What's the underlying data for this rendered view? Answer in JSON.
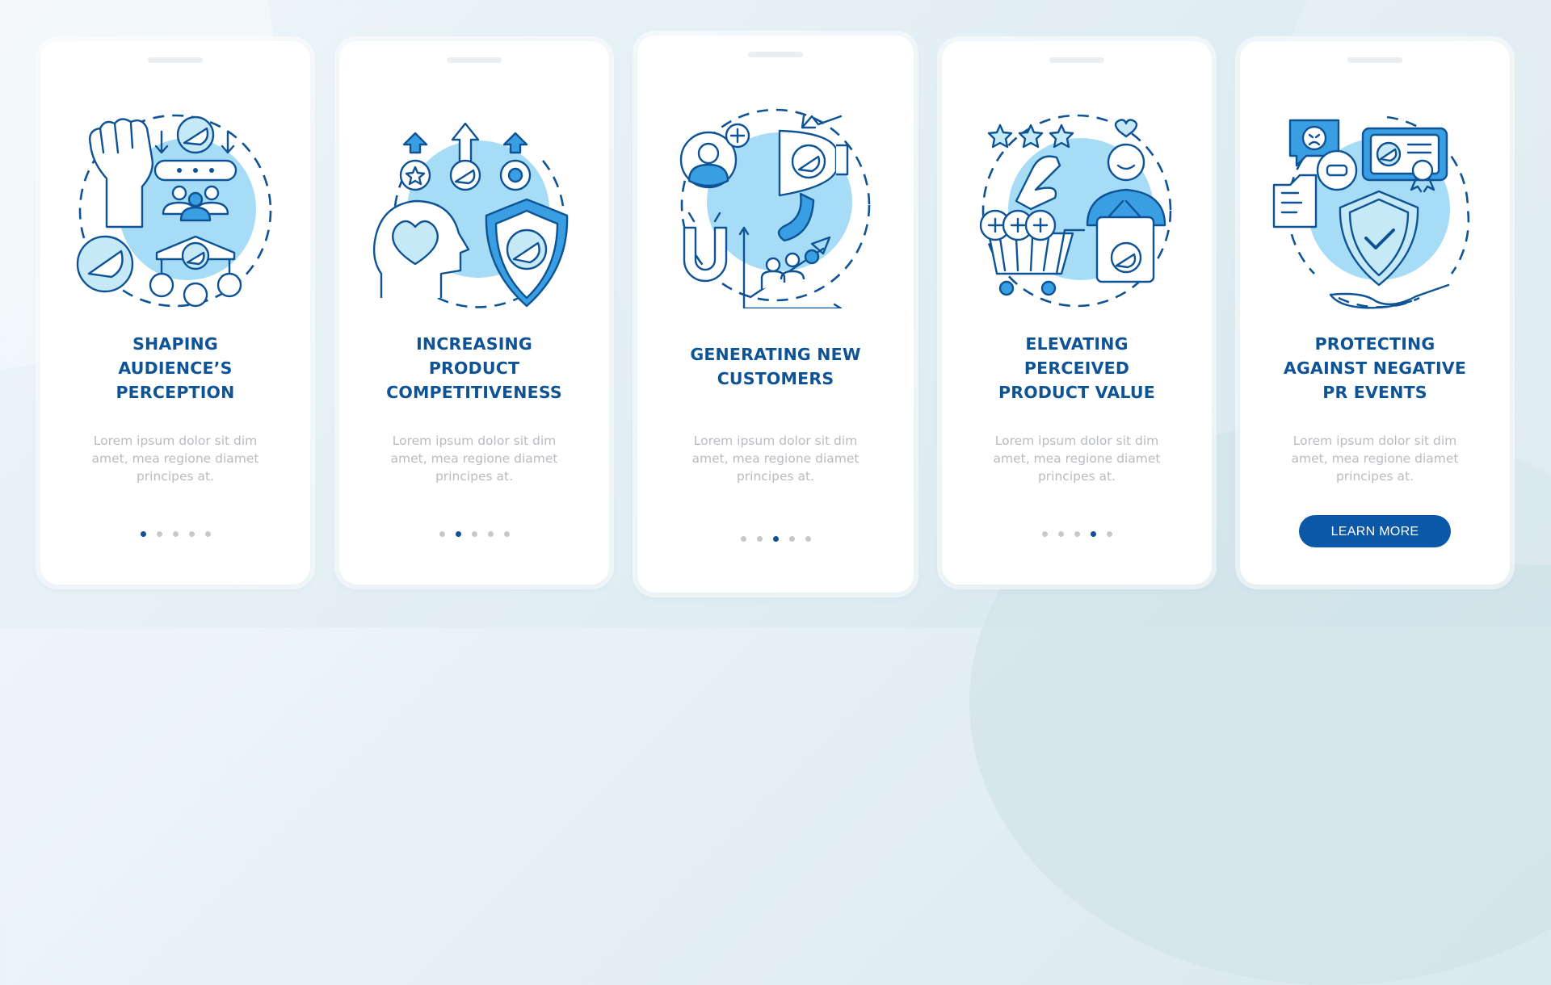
{
  "colors": {
    "title": "#0e5395",
    "description": "#b8bcc0",
    "dot_active": "#0e5395",
    "dot_inactive": "#c6c9cc",
    "button": "#0c58a8",
    "illustration_fill": "#a6dcf5"
  },
  "screens": [
    {
      "icon": "audience-perception-illustration",
      "title_lines": [
        "SHAPING",
        "AUDIENCE’S",
        "PERCEPTION"
      ],
      "description_lines": [
        "Lorem ipsum dolor sit dim",
        "amet, mea regione diamet",
        "principes at."
      ],
      "page_index": 1,
      "page_count": 5
    },
    {
      "icon": "product-competitiveness-illustration",
      "title_lines": [
        "INCREASING",
        "PRODUCT",
        "COMPETITIVENESS"
      ],
      "description_lines": [
        "Lorem ipsum dolor sit dim",
        "amet, mea regione diamet",
        "principes at."
      ],
      "page_index": 2,
      "page_count": 5
    },
    {
      "icon": "new-customers-illustration",
      "title_lines": [
        "GENERATING NEW",
        "CUSTOMERS"
      ],
      "description_lines": [
        "Lorem ipsum dolor sit dim",
        "amet, mea regione diamet",
        "principes at."
      ],
      "page_index": 3,
      "page_count": 5
    },
    {
      "icon": "perceived-value-illustration",
      "title_lines": [
        "ELEVATING",
        "PERCEIVED",
        "PRODUCT VALUE"
      ],
      "description_lines": [
        "Lorem ipsum dolor sit dim",
        "amet, mea regione diamet",
        "principes at."
      ],
      "page_index": 4,
      "page_count": 5
    },
    {
      "icon": "pr-protection-illustration",
      "title_lines": [
        "PROTECTING",
        "AGAINST NEGATIVE",
        "PR EVENTS"
      ],
      "description_lines": [
        "Lorem ipsum dolor sit dim",
        "amet, mea regione diamet",
        "principes at."
      ],
      "button_label": "LEARN MORE"
    }
  ]
}
